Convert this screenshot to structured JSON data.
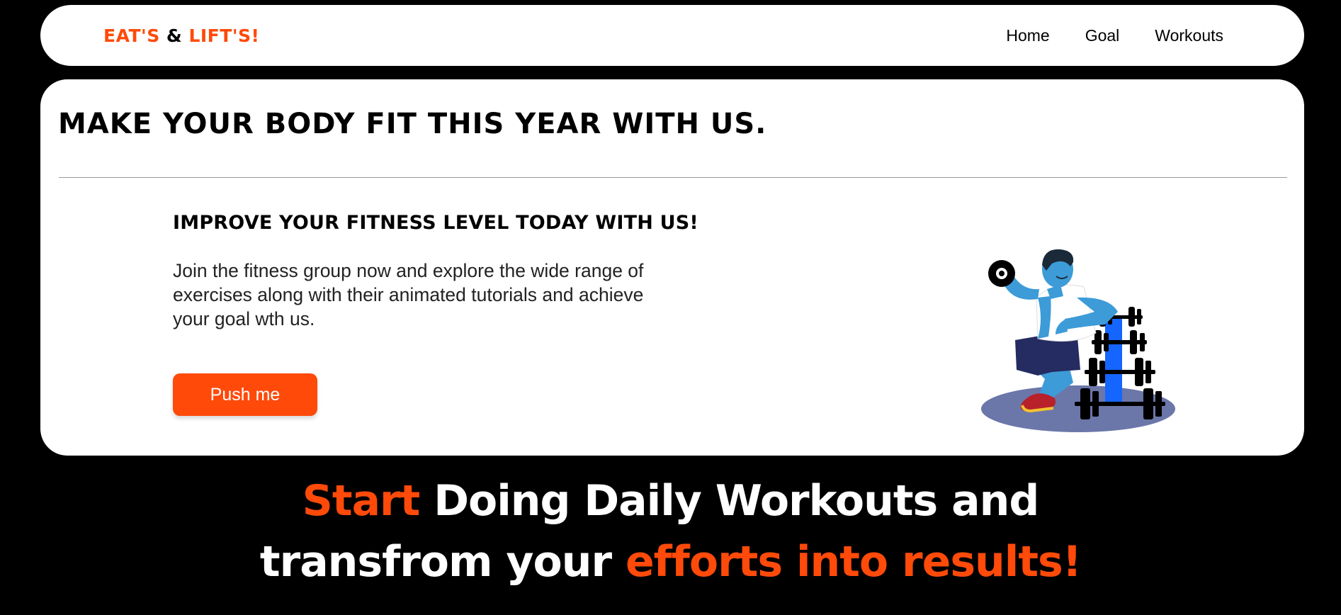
{
  "nav": {
    "logo": {
      "part1": "EAT'S",
      "amp": "&",
      "part2": "LIFT'S!"
    },
    "links": [
      "Home",
      "Goal",
      "Workouts"
    ]
  },
  "hero": {
    "title": "MAKE YOUR BODY FIT THIS YEAR WITH US.",
    "subtitle": "IMPROVE YOUR FITNESS LEVEL TODAY WITH US!",
    "description": "Join the fitness group now and explore the wide range of exercises along with their animated tutorials and achieve your goal wth us.",
    "button_label": "Push me",
    "illustration_icon": "man-with-dumbbell-illustration"
  },
  "tagline": {
    "line1_highlight": "Start",
    "line1_rest": " Doing Daily Workouts and",
    "line2_start": "transfrom your ",
    "line2_highlight": "efforts into results!"
  },
  "colors": {
    "accent": "#ff4a0a",
    "background": "#000000",
    "card": "#ffffff",
    "illustration_blue": "#3d9bd8",
    "illustration_floor": "#6b77a9"
  }
}
